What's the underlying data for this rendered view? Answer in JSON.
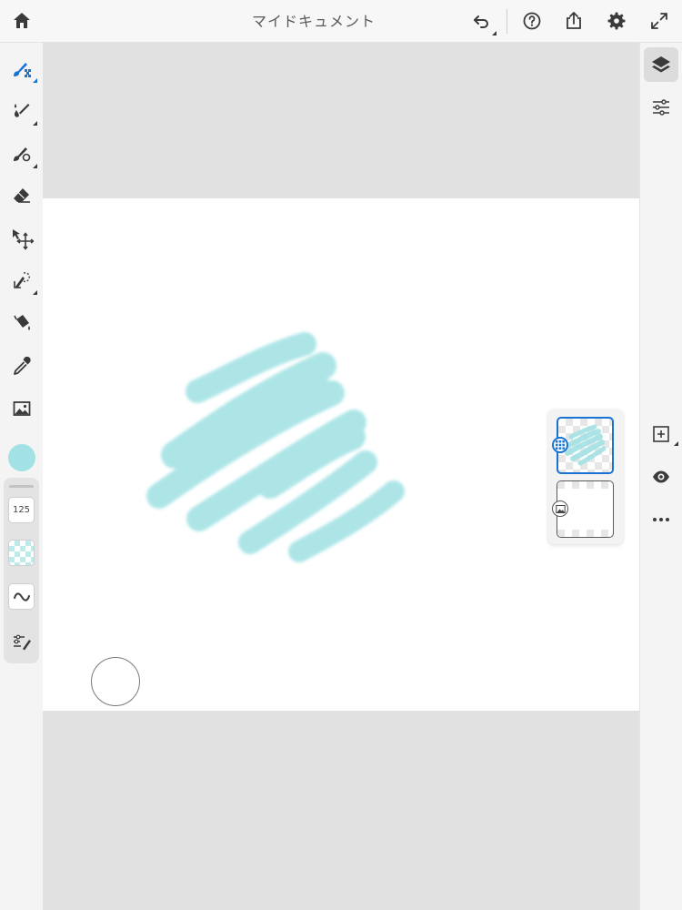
{
  "topbar": {
    "title": "マイドキュメント",
    "icons": [
      "home-icon",
      "undo-icon",
      "help-icon",
      "share-icon",
      "settings-icon",
      "fullscreen-icon"
    ]
  },
  "left_toolbar": {
    "tools": [
      "pixel-brush-icon",
      "live-brush-icon",
      "vector-brush-icon",
      "eraser-icon",
      "transform-icon",
      "selection-icon",
      "fill-icon",
      "eyedropper-icon",
      "image-icon"
    ],
    "active_tool": "pixel-brush-icon",
    "color": "#a2e2e4",
    "brush_size": "125",
    "brush_settings_icons": [
      "opacity-icon",
      "flow-icon",
      "brush-settings-icon"
    ]
  },
  "right_toolbar": {
    "icons": [
      "layers-icon",
      "layer-properties-icon",
      "add-layer-icon",
      "visibility-icon",
      "more-icon"
    ],
    "active": "layers-icon"
  },
  "layers_panel": {
    "layers": [
      {
        "type": "pixel",
        "selected": true,
        "badge": "pixel-layer-icon"
      },
      {
        "type": "background",
        "selected": false,
        "badge": "image-layer-icon"
      }
    ]
  },
  "colors": {
    "accent": "#1873d3",
    "paint": "#a2e2e4",
    "workspace": "#e1e1e1",
    "canvas": "#ffffff"
  }
}
